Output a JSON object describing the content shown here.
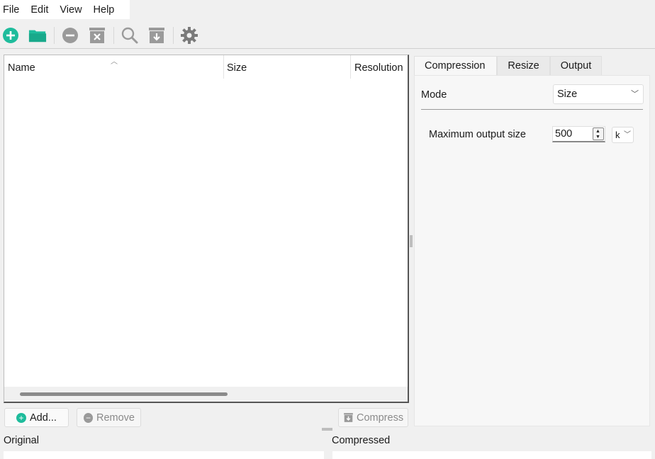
{
  "menu": [
    "File",
    "Edit",
    "View",
    "Help"
  ],
  "toolbar": {
    "icons": [
      "add-icon",
      "open-folder-icon",
      "remove-icon",
      "clear-icon",
      "search-icon",
      "compress-icon",
      "settings-icon"
    ],
    "accent": "#1ebc9c",
    "disabled": "#9a9a9a"
  },
  "table": {
    "columns": [
      "Name",
      "Size",
      "Resolution"
    ],
    "rows": []
  },
  "buttons": {
    "add": "Add...",
    "remove": "Remove",
    "compress": "Compress"
  },
  "tabs": [
    "Compression",
    "Resize",
    "Output"
  ],
  "compression": {
    "mode_label": "Mode",
    "mode_value": "Size",
    "max_label": "Maximum output size",
    "max_value": "500",
    "unit_value": "k"
  },
  "preview": {
    "original_label": "Original",
    "compressed_label": "Compressed"
  }
}
